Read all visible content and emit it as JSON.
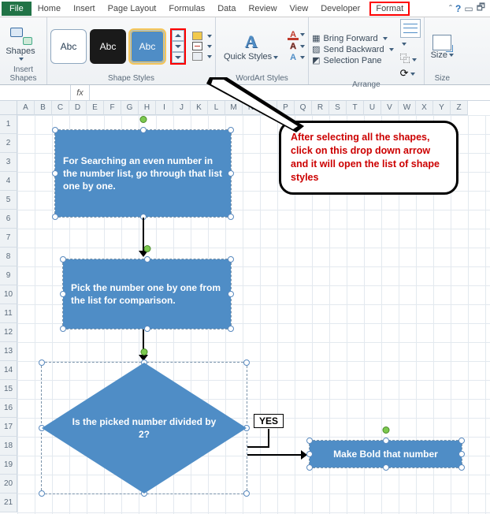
{
  "tabs": {
    "file": "File",
    "items": [
      "Home",
      "Insert",
      "Page Layout",
      "Formulas",
      "Data",
      "Review",
      "View",
      "Developer"
    ],
    "format": "Format"
  },
  "ribbon": {
    "insertShapes": {
      "label": "Insert Shapes",
      "btn": "Shapes"
    },
    "shapeStyles": {
      "label": "Shape Styles",
      "thumbText": "Abc",
      "fill": "Shape Fill",
      "outline": "Shape Outline",
      "effects": "Shape Effects"
    },
    "wordart": {
      "label": "WordArt Styles",
      "btn": "Quick Styles"
    },
    "arrange": {
      "label": "Arrange",
      "bringForward": "Bring Forward",
      "sendBackward": "Send Backward",
      "selectionPane": "Selection Pane"
    },
    "size": {
      "label": "Size",
      "btn": "Size"
    }
  },
  "fx": "fx",
  "columns": [
    "A",
    "B",
    "C",
    "D",
    "E",
    "F",
    "G",
    "H",
    "I",
    "J",
    "K",
    "L",
    "M",
    "N",
    "O",
    "P",
    "Q",
    "R",
    "S",
    "T",
    "U",
    "V",
    "W",
    "X",
    "Y",
    "Z"
  ],
  "rows": [
    "1",
    "2",
    "3",
    "4",
    "5",
    "6",
    "7",
    "8",
    "9",
    "10",
    "11",
    "12",
    "13",
    "14",
    "15",
    "16",
    "17",
    "18",
    "19",
    "20",
    "21"
  ],
  "shapes": {
    "proc1": "For Searching an even number in the number list, go through that list one by one.",
    "proc2": "Pick the number one by one from the list for comparison.",
    "decision": "Is the picked number divided  by 2?",
    "yes": "YES",
    "result": "Make Bold that number"
  },
  "callout": "After selecting all the shapes, click on this drop down  arrow and it will open the list of shape styles",
  "chart_data": {
    "type": "flowchart",
    "nodes": [
      {
        "id": "n1",
        "type": "process",
        "text": "For Searching an even number in the number list, go through that list one by one."
      },
      {
        "id": "n2",
        "type": "process",
        "text": "Pick the number one by one from the list for comparison."
      },
      {
        "id": "n3",
        "type": "decision",
        "text": "Is the picked number divided by 2?"
      },
      {
        "id": "n4",
        "type": "process",
        "text": "Make Bold that number"
      }
    ],
    "edges": [
      {
        "from": "n1",
        "to": "n2"
      },
      {
        "from": "n2",
        "to": "n3"
      },
      {
        "from": "n3",
        "to": "n4",
        "label": "YES"
      }
    ]
  }
}
